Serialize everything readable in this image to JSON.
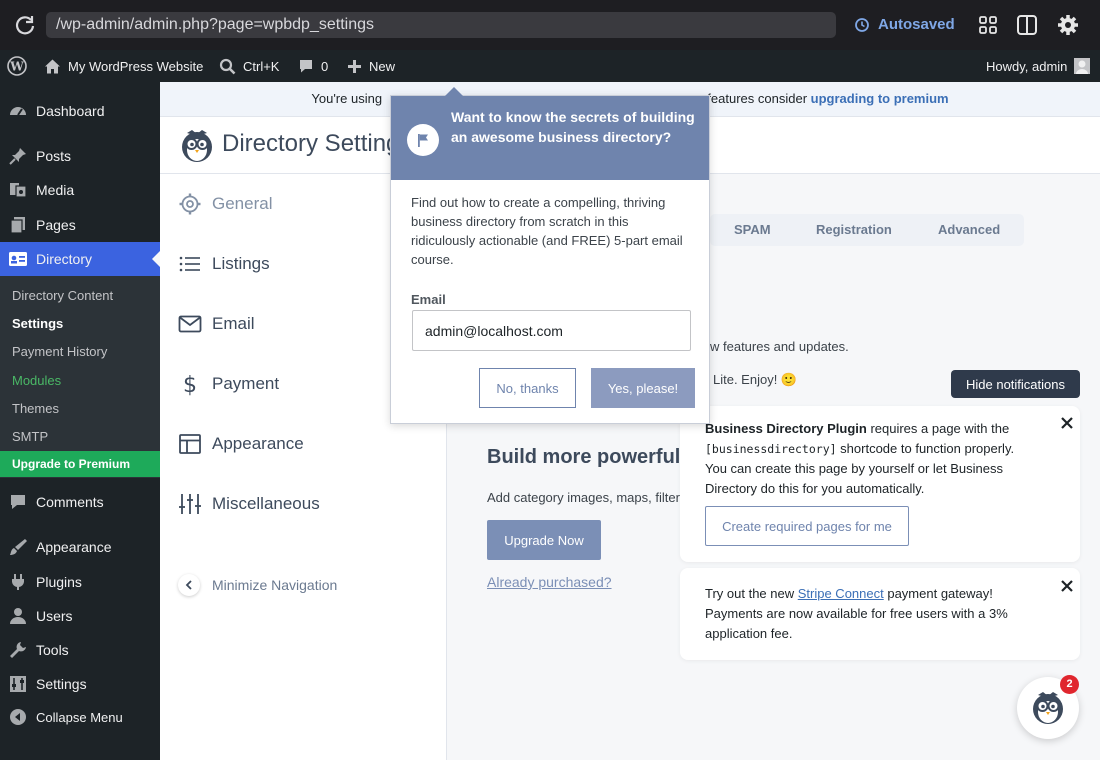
{
  "browser": {
    "url": "/wp-admin/admin.php?page=wpbdp_settings",
    "autosaved": "Autosaved"
  },
  "adminbar": {
    "site_name": "My WordPress Website",
    "search_shortcut": "Ctrl+K",
    "comments_count": "0",
    "new_label": "New",
    "howdy": "Howdy, admin"
  },
  "sidebar": {
    "dashboard": "Dashboard",
    "posts": "Posts",
    "media": "Media",
    "pages": "Pages",
    "directory": "Directory",
    "sub": {
      "directory_content": "Directory Content",
      "settings": "Settings",
      "payment_history": "Payment History",
      "modules": "Modules",
      "themes": "Themes",
      "smtp": "SMTP",
      "upgrade": "Upgrade to Premium"
    },
    "comments": "Comments",
    "appearance": "Appearance",
    "plugins": "Plugins",
    "users": "Users",
    "tools": "Tools",
    "settings": "Settings",
    "collapse": "Collapse Menu"
  },
  "notice": {
    "text_start": "You're using",
    "text_mid": "features consider",
    "link": "upgrading to premium"
  },
  "header": {
    "title": "Directory Setting"
  },
  "leftnav": {
    "general": "General",
    "listings": "Listings",
    "email": "Email",
    "payment": "Payment",
    "appearance": "Appearance",
    "misc": "Miscellaneous",
    "minimize": "Minimize Navigation"
  },
  "tabs": {
    "spam": "SPAM",
    "registration": "Registration",
    "advanced": "Advanced"
  },
  "main": {
    "features_text": "w features and updates.",
    "enjoy_text": "Lite. Enjoy! 🙂",
    "build_title": "Build more powerful",
    "add_text": "Add category images, maps, filter",
    "upgrade_button": "Upgrade Now",
    "already_purchased": "Already purchased?"
  },
  "popup": {
    "title": "Want to know the secrets of building an awesome business directory?",
    "body": "Find out how to create a compelling, thriving business directory from scratch in this ridiculously actionable (and FREE) 5-part email course.",
    "email_label": "Email",
    "email_value": "admin@localhost.com",
    "no_button": "No, thanks",
    "yes_button": "Yes, please!"
  },
  "notifications": {
    "hide_button": "Hide notifications",
    "card1": {
      "bold": "Business Directory Plugin",
      "text1": " requires a page with the",
      "code": "[businessdirectory]",
      "text2": " shortcode to function properly. You can create this page by yourself or let Business Directory do this for you automatically.",
      "button": "Create required pages for me"
    },
    "card2": {
      "text1": "Try out the new ",
      "link": "Stripe Connect",
      "text2": " payment gateway! Payments are now available for free users with a 3% application fee."
    },
    "badge_count": "2"
  },
  "colors": {
    "accent": "#3b63e0",
    "popup_header": "#6f84ad",
    "modules_green": "#4ab866",
    "upgrade_green": "#1eaa5a",
    "badge_red": "#e0262e"
  }
}
